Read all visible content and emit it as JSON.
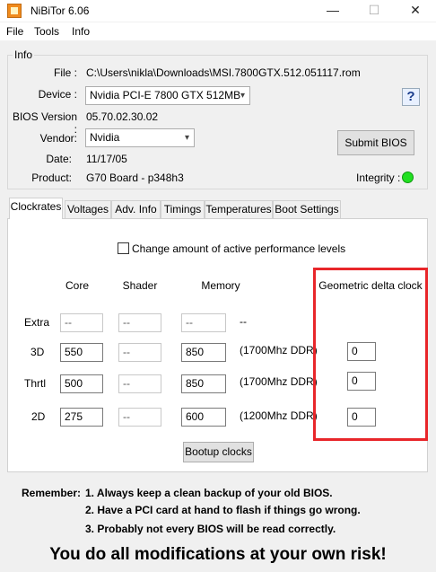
{
  "window": {
    "title": "NiBiTor 6.06",
    "minimize": "—",
    "maximize": "☐",
    "close": "✕"
  },
  "menu": {
    "file": "File",
    "tools": "Tools",
    "info": "Info"
  },
  "info": {
    "group_title": "Info",
    "file_label": "File :",
    "file_value": "C:\\Users\\nikla\\Downloads\\MSI.7800GTX.512.051117.rom",
    "device_label": "Device :",
    "device_value": "Nvidia PCI-E 7800 GTX 512MB",
    "bios_version_label": "BIOS Version :",
    "bios_version_value": "05.70.02.30.02",
    "vendor_label": "Vendor:",
    "vendor_value": "Nvidia",
    "date_label": "Date:",
    "date_value": "11/17/05",
    "product_label": "Product:",
    "product_value": "G70 Board - p348h3",
    "help_icon": "?",
    "submit_bios": "Submit BIOS",
    "integrity_label": "Integrity :",
    "integrity_color": "#22e022"
  },
  "tabs": [
    "Clockrates",
    "Voltages",
    "Adv. Info",
    "Timings",
    "Temperatures",
    "Boot Settings"
  ],
  "clockrates": {
    "change_levels_label": "Change amount of active performance levels",
    "change_levels_checked": false,
    "headers": {
      "core": "Core",
      "shader": "Shader",
      "memory": "Memory",
      "delta": "Geometric delta clock"
    },
    "rows": [
      {
        "label": "Extra",
        "core": "--",
        "shader": "--",
        "memory": "--",
        "note": "--",
        "delta": ""
      },
      {
        "label": "3D",
        "core": "550",
        "shader": "--",
        "memory": "850",
        "note": "(1700Mhz DDR)",
        "delta": "0"
      },
      {
        "label": "Thrtl",
        "core": "500",
        "shader": "--",
        "memory": "850",
        "note": "(1700Mhz DDR)",
        "delta": "0"
      },
      {
        "label": "2D",
        "core": "275",
        "shader": "--",
        "memory": "600",
        "note": "(1200Mhz DDR)",
        "delta": "0"
      }
    ],
    "bootup_button": "Bootup clocks",
    "highlight_color": "#e8262a"
  },
  "footer": {
    "remember_label": "Remember:",
    "line1": "1. Always keep a clean backup of your old BIOS.",
    "line2": "2. Have a PCI card at hand to flash if things go wrong.",
    "line3": "3. Probably not every BIOS will be read correctly.",
    "warning": "You do all modifications at your own risk!"
  }
}
